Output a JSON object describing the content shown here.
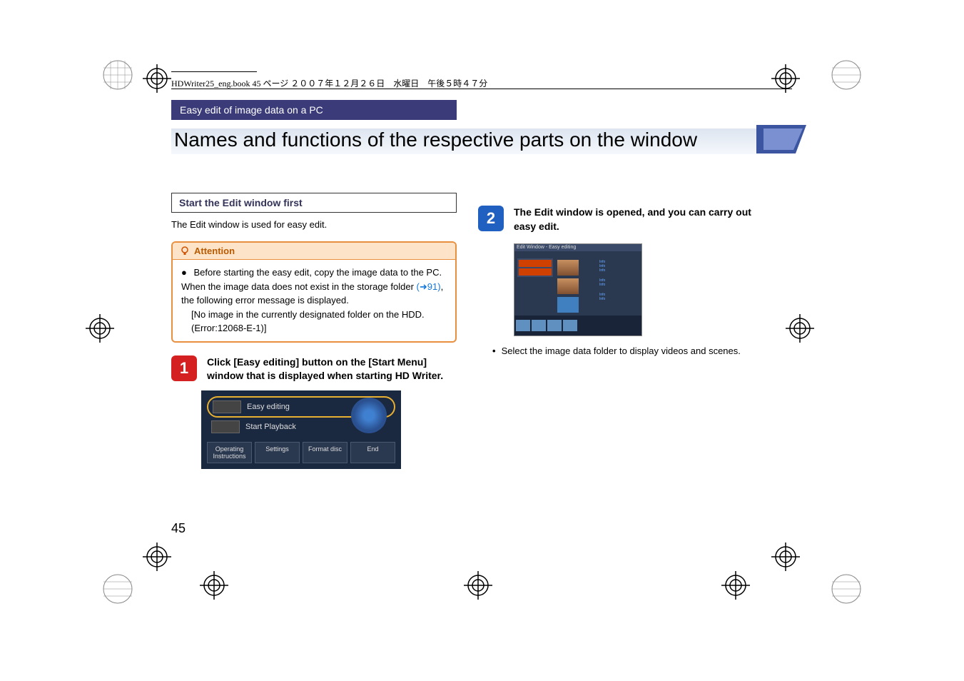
{
  "header": {
    "print_label": "HDWriter25_eng.book  45 ページ  ２００７年１２月２６日　水曜日　午後５時４７分"
  },
  "section_bar": "Easy edit of image data on a PC",
  "title": "Names and functions of the respective parts on the window",
  "left_column": {
    "sub_heading": "Start the Edit window first",
    "intro_text": "The Edit window is used for easy edit.",
    "attention": {
      "label": "Attention",
      "body_1": "Before starting the easy edit, copy the image data to the PC. When the image data does not exist in the storage folder ",
      "link": "(➜91)",
      "body_2": ", the following error message is displayed.",
      "body_3": "[No image in the currently designated folder on the HDD. (Error:12068-E-1)]"
    },
    "step1": {
      "num": "1",
      "text": "Click [Easy editing] button on the [Start Menu] window that is displayed when starting HD Writer.",
      "menu": {
        "easy_editing": "Easy editing",
        "start_playback": "Start Playback",
        "btn_instructions": "Operating Instructions",
        "btn_settings": "Settings",
        "btn_format": "Format disc",
        "btn_end": "End"
      }
    }
  },
  "right_column": {
    "step2": {
      "num": "2",
      "text": "The Edit window is opened, and you can carry out easy edit.",
      "bullet": "Select the image data folder to display videos and scenes.",
      "ss2_title": "Edit Window - Easy editing"
    }
  },
  "page_number": "45"
}
